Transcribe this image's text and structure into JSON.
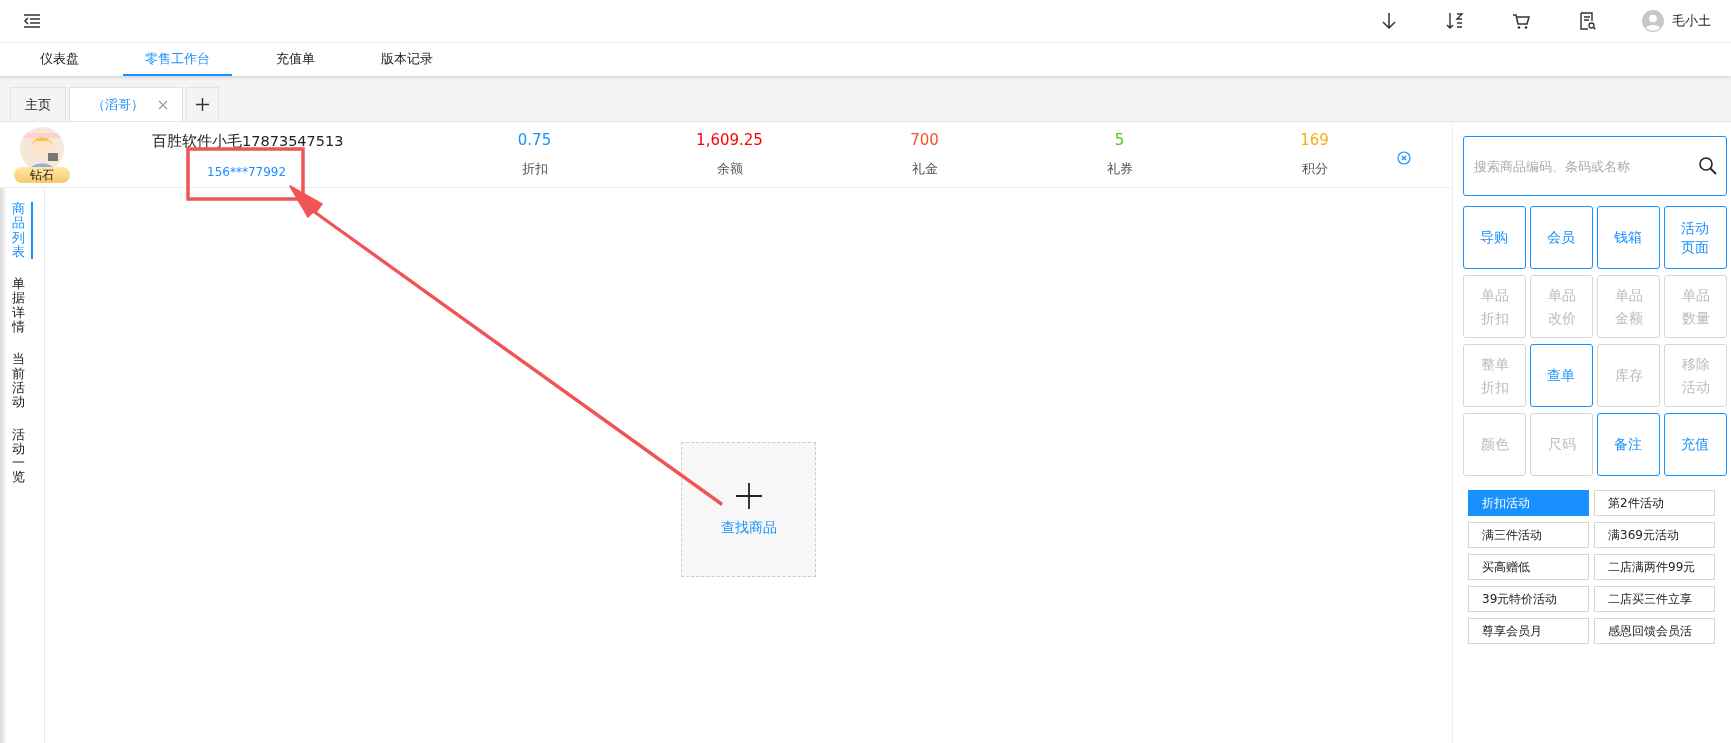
{
  "header": {
    "user": "毛小土"
  },
  "nav": [
    {
      "label": "仪表盘",
      "selected": false
    },
    {
      "label": "零售工作台",
      "selected": true
    },
    {
      "label": "充值单",
      "selected": false
    },
    {
      "label": "版本记录",
      "selected": false
    }
  ],
  "doc_tabs": [
    {
      "label": "主页",
      "selected": false,
      "closable": false
    },
    {
      "label": "（滔哥）",
      "selected": true,
      "closable": true
    }
  ],
  "customer": {
    "badge": "钻石",
    "name": "百胜软件小毛17873547513",
    "phone": "156***77992",
    "stats": [
      {
        "value": "0.75",
        "label": "折扣",
        "color": "#1890ff"
      },
      {
        "value": "1,609.25",
        "label": "余额",
        "color": "#ff0000"
      },
      {
        "value": "700",
        "label": "礼金",
        "color": "#f5522d"
      },
      {
        "value": "5",
        "label": "礼券",
        "color": "#52c41a"
      },
      {
        "value": "169",
        "label": "积分",
        "color": "#faad14"
      }
    ]
  },
  "side_tabs": [
    {
      "label": "商品列表",
      "selected": true
    },
    {
      "label": "单据详情",
      "selected": false
    },
    {
      "label": "当前活动",
      "selected": false
    },
    {
      "label": "活动一览",
      "selected": false
    }
  ],
  "add_product": {
    "label": "查找商品"
  },
  "search": {
    "placeholder": "搜索商品编码、条码或名称"
  },
  "actions": [
    {
      "label": "导购",
      "disabled": false
    },
    {
      "label": "会员",
      "disabled": false
    },
    {
      "label": "钱箱",
      "disabled": false
    },
    {
      "label": "活动页面",
      "disabled": false
    },
    {
      "label": "单品折扣",
      "disabled": true
    },
    {
      "label": "单品改价",
      "disabled": true
    },
    {
      "label": "单品金额",
      "disabled": true
    },
    {
      "label": "单品数量",
      "disabled": true
    },
    {
      "label": "整单折扣",
      "disabled": true
    },
    {
      "label": "查单",
      "disabled": false
    },
    {
      "label": "库存",
      "disabled": true
    },
    {
      "label": "移除活动",
      "disabled": true
    },
    {
      "label": "颜色",
      "disabled": true
    },
    {
      "label": "尺码",
      "disabled": true
    },
    {
      "label": "备注",
      "disabled": false
    },
    {
      "label": "充值",
      "disabled": false
    }
  ],
  "promotions": [
    {
      "label": "折扣活动",
      "selected": true
    },
    {
      "label": "第2件活动",
      "selected": false
    },
    {
      "label": "满三件活动",
      "selected": false
    },
    {
      "label": "满369元活动",
      "selected": false
    },
    {
      "label": "买高赠低",
      "selected": false
    },
    {
      "label": "二店满两件99元",
      "selected": false
    },
    {
      "label": "39元特价活动",
      "selected": false
    },
    {
      "label": "二店买三件立享",
      "selected": false
    },
    {
      "label": "尊享会员月",
      "selected": false
    },
    {
      "label": "感恩回馈会员活",
      "selected": false
    }
  ]
}
